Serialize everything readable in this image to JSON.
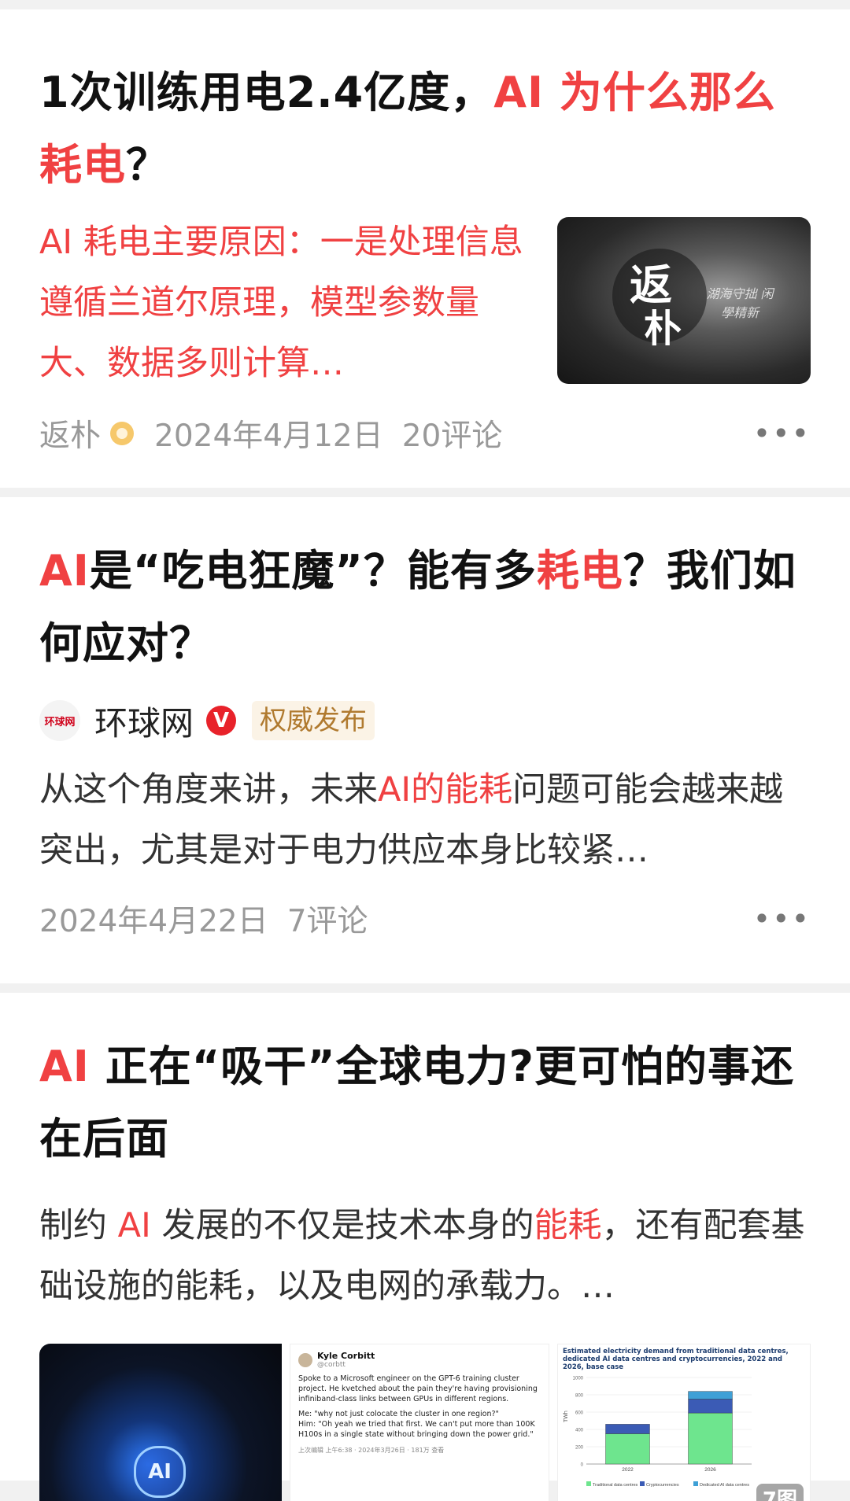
{
  "articles": [
    {
      "title_parts": [
        "1次训练用电2.4亿度，",
        "AI 为什么那么耗电",
        "？"
      ],
      "abstract": "AI 耗电主要原因：一是处理信息遵循兰道尔原理，模型参数量大、数据多则计算…",
      "thumb": {
        "logo_char_1": "返",
        "logo_char_2": "朴",
        "tagline": "湖海守拙 闲學精新"
      },
      "author": "返朴",
      "date": "2024年4月12日",
      "comments": "20评论",
      "more": "•••"
    },
    {
      "title_parts": [
        "AI",
        "是“吃电狂魔”？能有多",
        "耗电",
        "？我们如何应对？"
      ],
      "source_logo": "环球网",
      "source_name": "环球网",
      "verified_mark": "V",
      "badge": "权威发布",
      "body_parts": [
        "从这个角度来讲，未来",
        "AI的能耗",
        "问题可能会越来越突出，尤其是对于电力供应本身比较紧…"
      ],
      "date": "2024年4月22日",
      "comments": "7评论",
      "more": "•••"
    },
    {
      "title_parts": [
        "AI",
        " 正在“吸干”全球电力?更可怕的事还在后面"
      ],
      "body_parts": [
        "制约 ",
        "AI",
        " 发展的不仅是技术本身的",
        "能耗",
        "，还有配套基础设施的能耗，以及电网的承载力。…"
      ],
      "chip_label": "AI",
      "tweet": {
        "name": "Kyle Corbitt",
        "handle": "@corbtt",
        "text": "Spoke to a Microsoft engineer on the GPT-6 training cluster project. He kvetched about the pain they're having provisioning infiniband-class links between GPUs in different regions.",
        "text2": "Me: \"why not just colocate the cluster in one region?\"\nHim: \"Oh yeah we tried that first. We can't put more than 100K H100s in a single state without bringing down the power grid.\"",
        "meta": "上次编辑 上午6:38 · 2024年3月26日 · 181万 查看"
      },
      "chart": {
        "title": "Estimated electricity demand from traditional data centres, dedicated AI data centres and cryptocurrencies, 2022 and 2026, base case",
        "ylabel": "TWh",
        "legend": [
          "Traditional data centres",
          "Cryptocurrencies",
          "Dedicated AI data centres"
        ],
        "colors": {
          "traditional": "#6ee58e",
          "crypto": "#3b5bb5",
          "ai": "#3fa0d6"
        }
      },
      "image_count": "7图"
    }
  ],
  "chart_data": {
    "type": "bar",
    "title": "Estimated electricity demand from traditional data centres, dedicated AI data centres and cryptocurrencies, 2022 and 2026, base case",
    "ylabel": "TWh",
    "categories": [
      "2022",
      "2026"
    ],
    "ylim": [
      0,
      1000
    ],
    "yticks": [
      0,
      200,
      400,
      600,
      800,
      1000
    ],
    "series": [
      {
        "name": "Traditional data centres",
        "values": [
          350,
          590
        ]
      },
      {
        "name": "Cryptocurrencies",
        "values": [
          110,
          160
        ]
      },
      {
        "name": "Dedicated AI data centres",
        "values": [
          0,
          90
        ]
      }
    ],
    "legend_position": "bottom"
  }
}
